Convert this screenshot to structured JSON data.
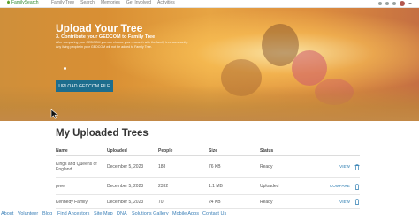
{
  "topbar": {
    "brand": "FamilySearch",
    "nav": [
      "Family Tree",
      "Search",
      "Memories",
      "Get Involved",
      "Activities"
    ]
  },
  "hero": {
    "title": "Upload Your Tree",
    "subtitle": "3. Contribute your GEDCOM to Family Tree",
    "description": "After comparing your GEDCOM you can choose your research with the family tree community. Any living people in your GEDCOM will not be added to Family Tree.",
    "button_label": "UPLOAD GEDCOM FILE"
  },
  "trees": {
    "title": "My Uploaded Trees",
    "columns": [
      "Name",
      "Uploaded",
      "People",
      "Size",
      "Status"
    ],
    "rows": [
      {
        "name": "Kings and Queens of England",
        "uploaded": "December 5, 2023",
        "people": "188",
        "size": "76 KB",
        "status": "Ready",
        "action": "VIEW"
      },
      {
        "name": "pree",
        "uploaded": "December 5, 2023",
        "people": "2332",
        "size": "1.1 MB",
        "status": "Uploaded",
        "action": "COMPARE"
      },
      {
        "name": "Kennedy Family",
        "uploaded": "December 5, 2023",
        "people": "70",
        "size": "24 KB",
        "status": "Ready",
        "action": "VIEW"
      }
    ]
  },
  "footer": {
    "links": [
      "About",
      "Volunteer",
      "Blog",
      "Find Ancestors",
      "Site Map",
      "DNA",
      "Solutions Gallery",
      "Mobile Apps",
      "Contact Us"
    ]
  },
  "colors": {
    "brand_green": "#2e8b2e",
    "button_blue": "#1d6d8d",
    "link_blue": "#2a7bb0",
    "hero_orange": "#dd9a3c"
  },
  "icons": [
    "leaf-icon",
    "trash-icon",
    "mouse-cursor-icon"
  ]
}
